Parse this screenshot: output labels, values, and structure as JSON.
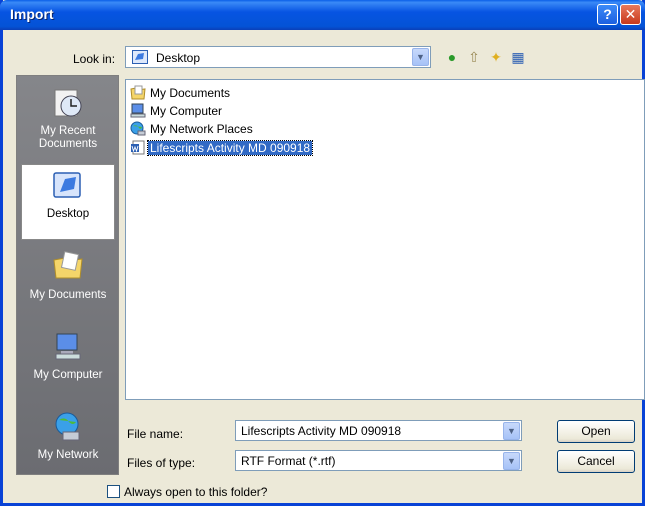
{
  "window": {
    "title": "Import"
  },
  "title_buttons": {
    "help": "?",
    "close": "✕"
  },
  "lookin": {
    "label": "Look in:",
    "value": "Desktop"
  },
  "places": [
    {
      "label": "My Recent Documents",
      "icon": "recent-documents-icon"
    },
    {
      "label": "Desktop",
      "icon": "desktop-icon"
    },
    {
      "label": "My Documents",
      "icon": "my-documents-icon"
    },
    {
      "label": "My Computer",
      "icon": "my-computer-icon"
    },
    {
      "label": "My Network",
      "icon": "my-network-icon"
    }
  ],
  "files": [
    {
      "name": "My Documents",
      "icon": "folder-documents-icon"
    },
    {
      "name": "My Computer",
      "icon": "computer-icon"
    },
    {
      "name": "My Network Places",
      "icon": "network-icon"
    },
    {
      "name": "Lifescripts Activity MD 090918",
      "icon": "word-document-icon"
    }
  ],
  "filename": {
    "label": "File name:",
    "value": "Lifescripts Activity MD 090918"
  },
  "filetype": {
    "label": "Files of type:",
    "value": "RTF Format (*.rtf)"
  },
  "buttons": {
    "open": "Open",
    "cancel": "Cancel"
  },
  "always_open": {
    "label": "Always open to this folder?",
    "checked": false
  }
}
